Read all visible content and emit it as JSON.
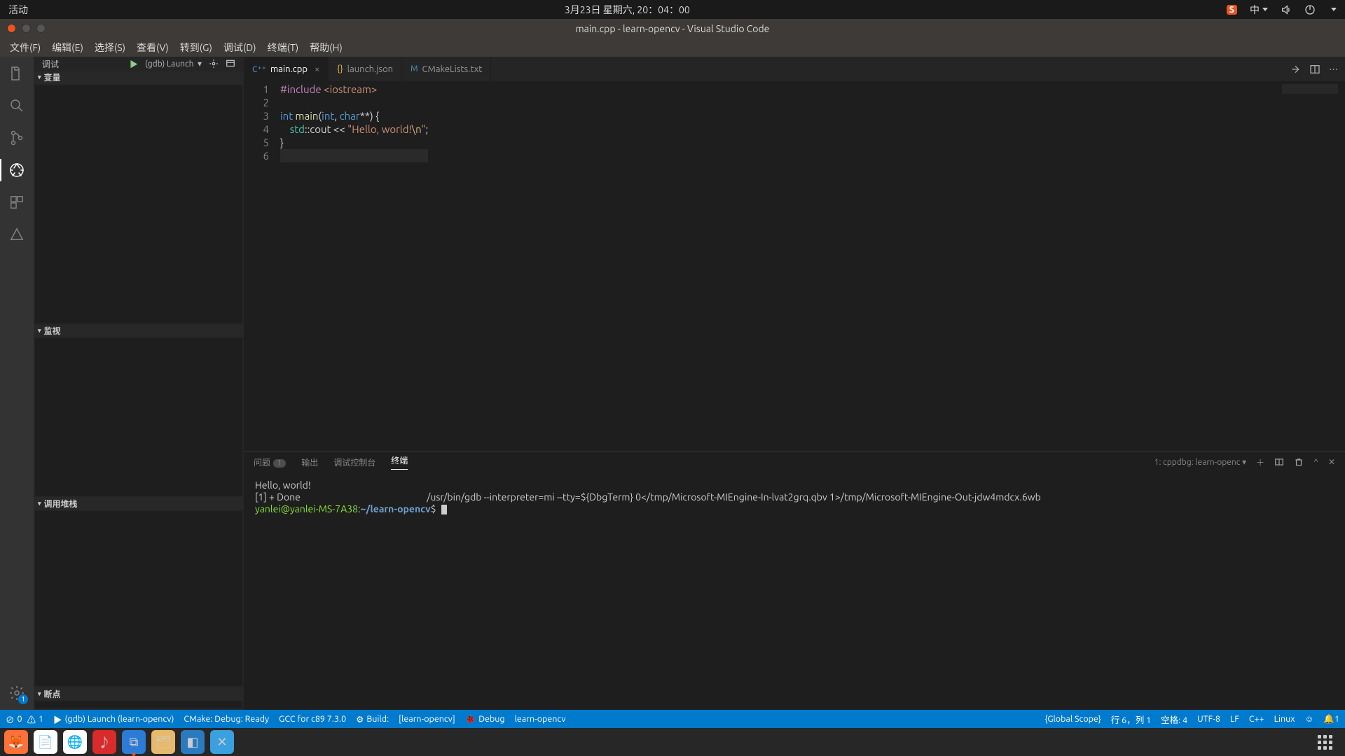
{
  "gnome": {
    "activities": "活动",
    "clock": "3月23日 星期六, 20：04：00",
    "ime_badge": "S",
    "lang": "中"
  },
  "window": {
    "title": "main.cpp - learn-opencv - Visual Studio Code"
  },
  "menu": {
    "items": [
      "文件(F)",
      "编辑(E)",
      "选择(S)",
      "查看(V)",
      "转到(G)",
      "调试(D)",
      "终端(T)",
      "帮助(H)"
    ]
  },
  "sidebar": {
    "head": "调试",
    "launch_config": "(gdb) Launch",
    "sections": {
      "variables": "变量",
      "watch": "监视",
      "callstack": "调用堆栈",
      "breakpoints": "断点"
    }
  },
  "tabs": {
    "items": [
      {
        "icon": "C⁺⁺",
        "label": "main.cpp",
        "active": true,
        "dirty": false
      },
      {
        "icon": "{}",
        "label": "launch.json",
        "active": false
      },
      {
        "icon": "M",
        "label": "CMakeLists.txt",
        "active": false
      }
    ]
  },
  "code": {
    "lines": [
      {
        "n": 1,
        "seg": [
          [
            "k-pre",
            "#include"
          ],
          [
            "k-punc",
            " "
          ],
          [
            "k-inc",
            "<iostream>"
          ]
        ]
      },
      {
        "n": 2,
        "seg": []
      },
      {
        "n": 3,
        "seg": [
          [
            "k-type",
            "int"
          ],
          [
            "k-punc",
            " "
          ],
          [
            "k-fn",
            "main"
          ],
          [
            "k-punc",
            "("
          ],
          [
            "k-type",
            "int"
          ],
          [
            "k-punc",
            ", "
          ],
          [
            "k-type",
            "char"
          ],
          [
            "k-punc",
            "**"
          ],
          [
            "k-punc",
            ") {"
          ]
        ]
      },
      {
        "n": 4,
        "seg": [
          [
            "k-punc",
            "    "
          ],
          [
            "k-ns",
            "std"
          ],
          [
            "k-punc",
            "::cout << "
          ],
          [
            "k-str",
            "\"Hello, world!"
          ],
          [
            "k-esc",
            "\\n"
          ],
          [
            "k-str",
            "\""
          ],
          [
            "k-punc",
            ";"
          ]
        ]
      },
      {
        "n": 5,
        "seg": [
          [
            "k-punc",
            "}"
          ]
        ]
      },
      {
        "n": 6,
        "seg": [],
        "current": true
      }
    ]
  },
  "panel": {
    "tabs": {
      "problems": "问题",
      "problems_count": "1",
      "output": "输出",
      "debug_console": "调试控制台",
      "terminal": "终端"
    },
    "term_select": "1: cppdbg: learn-openc",
    "terminal": {
      "line1": "Hello, world!",
      "line2_a": "[1] + Done",
      "line2_b": "/usr/bin/gdb --interpreter=mi --tty=${DbgTerm} 0</tmp/Microsoft-MIEngine-In-lvat2grq.qbv 1>/tmp/Microsoft-MIEngine-Out-jdw4mdcx.6wb",
      "prompt_user": "yanlei@yanlei-MS-7A38",
      "prompt_sep": ":",
      "prompt_path": "~/learn-opencv",
      "prompt_dollar": "$"
    }
  },
  "status": {
    "errors": "0",
    "warnings": "1",
    "launch": "(gdb) Launch (learn-opencv)",
    "cmake": "CMake: Debug: Ready",
    "kit": "GCC for c89 7.3.0",
    "build": "Build:",
    "target": "[learn-opencv]",
    "debug": "Debug",
    "debug_t": "learn-opencv",
    "scope": "{Global Scope}",
    "pos": "行 6，列 1",
    "spaces": "空格: 4",
    "enc": "UTF-8",
    "eol": "LF",
    "lang": "C++",
    "os": "Linux"
  },
  "dock": {
    "items": [
      {
        "name": "firefox",
        "bg": "#ff7139",
        "glyph": "🦊"
      },
      {
        "name": "libreoffice",
        "bg": "#ffffff",
        "glyph": "📄"
      },
      {
        "name": "chrome",
        "bg": "#ffffff",
        "glyph": "🌐"
      },
      {
        "name": "netease",
        "bg": "#d92b2b",
        "glyph": "♪"
      },
      {
        "name": "vscode",
        "bg": "#2c7bd6",
        "glyph": "⧉",
        "running": true
      },
      {
        "name": "files",
        "bg": "#e8b96b",
        "glyph": "🗂"
      },
      {
        "name": "app1",
        "bg": "#2a7ac0",
        "glyph": "◧"
      },
      {
        "name": "app2",
        "bg": "#3aa0e0",
        "glyph": "✕"
      }
    ]
  }
}
